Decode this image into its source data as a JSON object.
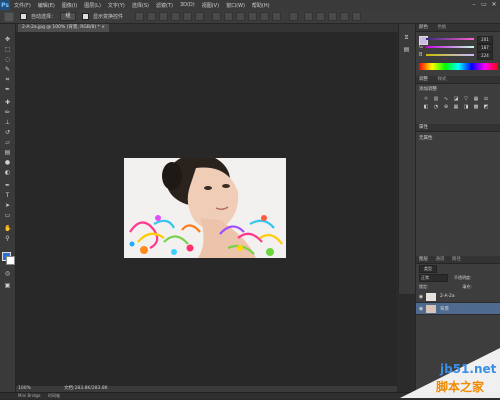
{
  "app": {
    "logo": "Ps"
  },
  "menu": [
    "文件(F)",
    "编辑(E)",
    "图像(I)",
    "图层(L)",
    "文字(Y)",
    "选择(S)",
    "滤镜(T)",
    "3D(D)",
    "视图(V)",
    "窗口(W)",
    "帮助(H)"
  ],
  "window_controls": {
    "minimize": "–",
    "restore": "▭",
    "close": "✕"
  },
  "options": {
    "auto_select_label": "自动选择：",
    "auto_select_value": "组",
    "transform_label": "显示变换控件"
  },
  "document": {
    "tab_label": "2-A-2a.jpg @ 100% (背景, RGB/8) * ×"
  },
  "status": {
    "zoom": "100%",
    "doc_info": "文档:283.8K/283.8K"
  },
  "bottom": {
    "mini_bridge": "Mini Bridge",
    "timeline": "时间轴"
  },
  "panels": {
    "color_tab": "颜色",
    "swatches_tab": "色板",
    "sliders": [
      {
        "channel": "R",
        "value": "201",
        "color": "#ff4040"
      },
      {
        "channel": "G",
        "value": "187",
        "color": "#40ff40"
      },
      {
        "channel": "B",
        "value": "224",
        "color": "#4080ff"
      }
    ],
    "adjust_tab": "调整",
    "styles_tab": "样式",
    "adjust_title": "添加调整",
    "properties_tab": "属性",
    "properties_text": "无属性",
    "layers_tab": "图层",
    "channels_tab": "通道",
    "paths_tab": "路径",
    "kind_label": "类型",
    "blend_mode": "正常",
    "opacity_label": "不透明度:",
    "lock_label": "锁定:",
    "fill_label": "填充:",
    "layers": [
      {
        "name": "2-A-2a",
        "active": false
      },
      {
        "name": "背景",
        "active": true
      }
    ]
  },
  "watermark": {
    "site": "jb51.net",
    "text": "脚本之家"
  }
}
